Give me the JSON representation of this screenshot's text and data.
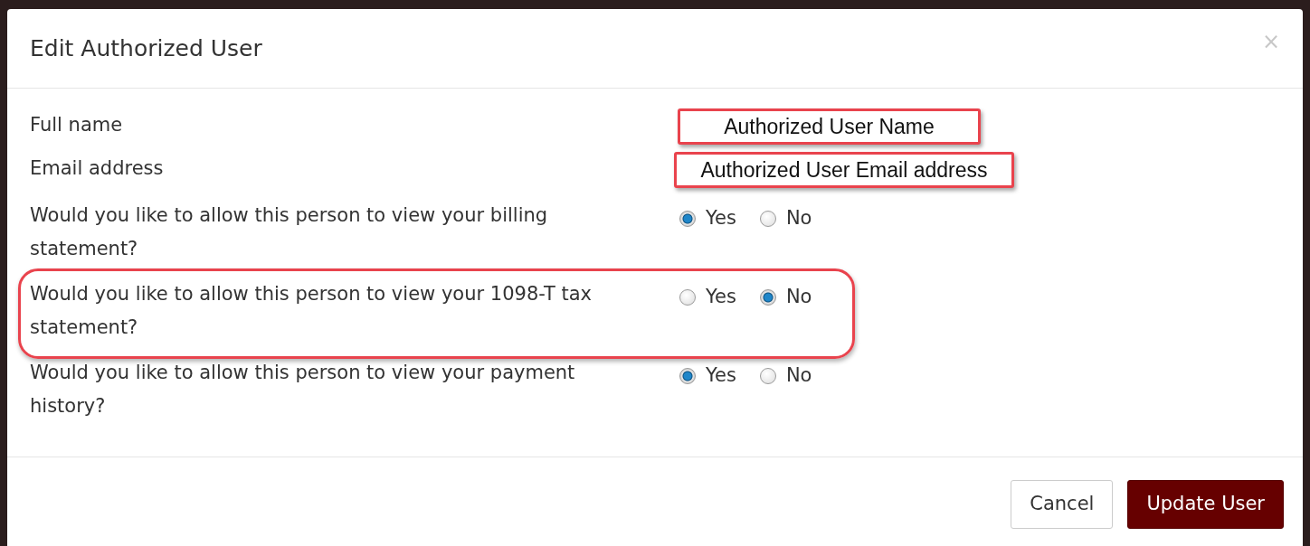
{
  "modal": {
    "title": "Edit Authorized User",
    "close": "×"
  },
  "fields": [
    {
      "label": "Full name",
      "value": "Authorized User Name",
      "highlighted": true
    },
    {
      "label": "Email address",
      "value": "Authorized User Email address",
      "highlighted": true
    }
  ],
  "questions": [
    {
      "label": "Would you like to allow this person to view your billing statement?",
      "highlighted": false,
      "options": [
        {
          "label": "Yes",
          "selected": true
        },
        {
          "label": "No",
          "selected": false
        }
      ]
    },
    {
      "label": "Would you like to allow this person to view your 1098-T tax statement?",
      "highlighted": true,
      "options": [
        {
          "label": "Yes",
          "selected": false
        },
        {
          "label": "No",
          "selected": true
        }
      ]
    },
    {
      "label": "Would you like to allow this person to view your payment history?",
      "highlighted": false,
      "options": [
        {
          "label": "Yes",
          "selected": true
        },
        {
          "label": "No",
          "selected": false
        }
      ]
    }
  ],
  "buttons": [
    {
      "label": "Cancel",
      "kind": "secondary"
    },
    {
      "label": "Update User",
      "kind": "primary"
    }
  ]
}
